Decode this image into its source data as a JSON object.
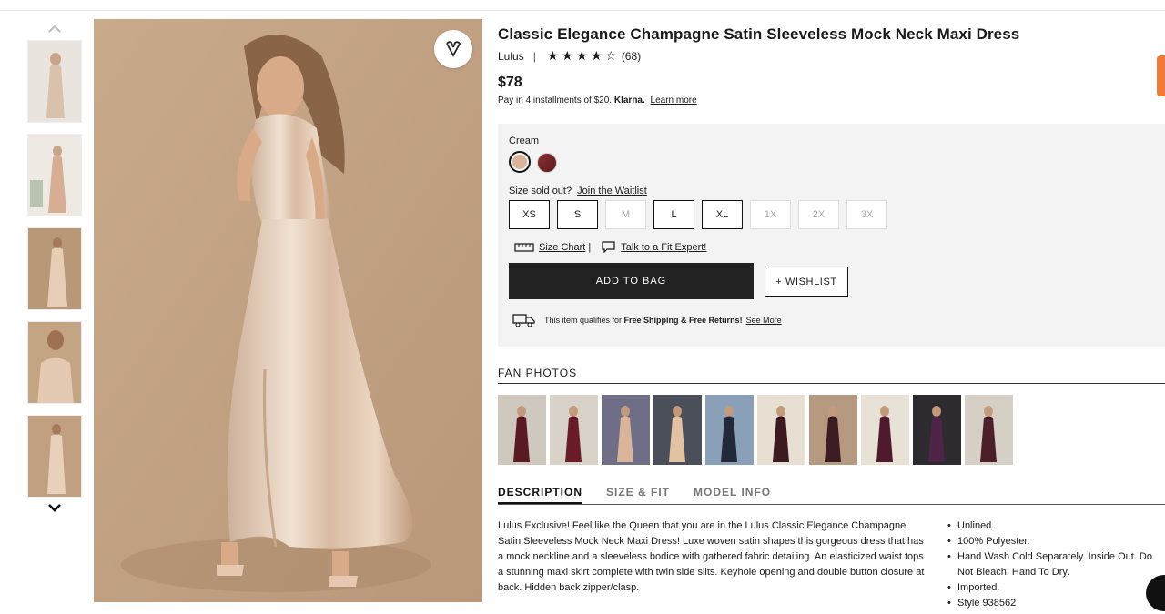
{
  "product": {
    "title": "Classic Elegance Champagne Satin Sleeveless Mock Neck Maxi Dress",
    "brand": "Lulus",
    "separator": "|",
    "rating_stars": 4,
    "rating_max": 5,
    "review_count": "(68)",
    "price": "$78",
    "installments_text": "Pay in 4 installments of $20.",
    "installments_provider": "Klarna.",
    "learn_more": "Learn more"
  },
  "options": {
    "color_label": "Cream",
    "swatches": [
      {
        "name": "Cream",
        "color": "#d9b49b",
        "selected": true
      },
      {
        "name": "Burgundy",
        "color": "#7a2a2c",
        "selected": false
      }
    ],
    "size_label": "Size sold out?",
    "waitlist_link": "Join the Waitlist",
    "sizes": [
      {
        "label": "XS",
        "available": true
      },
      {
        "label": "S",
        "available": true
      },
      {
        "label": "M",
        "available": false
      },
      {
        "label": "L",
        "available": true
      },
      {
        "label": "XL",
        "available": true
      },
      {
        "label": "1X",
        "available": false
      },
      {
        "label": "2X",
        "available": false
      },
      {
        "label": "3X",
        "available": false
      }
    ],
    "size_chart": "Size Chart",
    "fit_sep": "|",
    "fit_expert": "Talk to a Fit Expert!",
    "add_to_bag": "ADD TO BAG",
    "wishlist": "+ WISHLIST",
    "shipping_text": "This item qualifies for",
    "shipping_bold": "Free Shipping & Free Returns!",
    "see_more": "See More"
  },
  "fan_photos": {
    "heading": "FAN PHOTOS",
    "photos": [
      {
        "dress": "#5a1a24",
        "bg": "#cfc8bf"
      },
      {
        "dress": "#6a1d28",
        "bg": "#d8d2c9"
      },
      {
        "dress": "#d9b49b",
        "bg": "#6e6e86"
      },
      {
        "dress": "#e3c2a4",
        "bg": "#4a4f5a"
      },
      {
        "dress": "#222a3a",
        "bg": "#8aa0b8"
      },
      {
        "dress": "#3b1a20",
        "bg": "#e6dfd2"
      },
      {
        "dress": "#3a1c22",
        "bg": "#b59a80"
      },
      {
        "dress": "#4f1a2e",
        "bg": "#e8e1d5"
      },
      {
        "dress": "#4e2448",
        "bg": "#2d2a30"
      },
      {
        "dress": "#4d1f2a",
        "bg": "#d6cfc6"
      }
    ]
  },
  "tabs": [
    "DESCRIPTION",
    "SIZE & FIT",
    "MODEL INFO"
  ],
  "description": "Lulus Exclusive! Feel like the Queen that you are in the Lulus Classic Elegance Champagne Satin Sleeveless Mock Neck Maxi Dress! Luxe woven satin shapes this gorgeous dress that has a mock neckline and a sleeveless bodice with gathered fabric detailing. An elasticized waist tops a stunning maxi skirt complete with twin side slits. Keyhole opening and double button closure at back. Hidden back zipper/clasp.",
  "details": [
    "Unlined.",
    "100% Polyester.",
    "Hand Wash Cold Separately. Inside Out. Do Not Bleach. Hand To Dry.",
    "Imported.",
    "Style 938562"
  ],
  "colors": {
    "accent_tab": "#f07a36",
    "button_dark": "#222222",
    "panel_bg": "#f3f3f3"
  }
}
